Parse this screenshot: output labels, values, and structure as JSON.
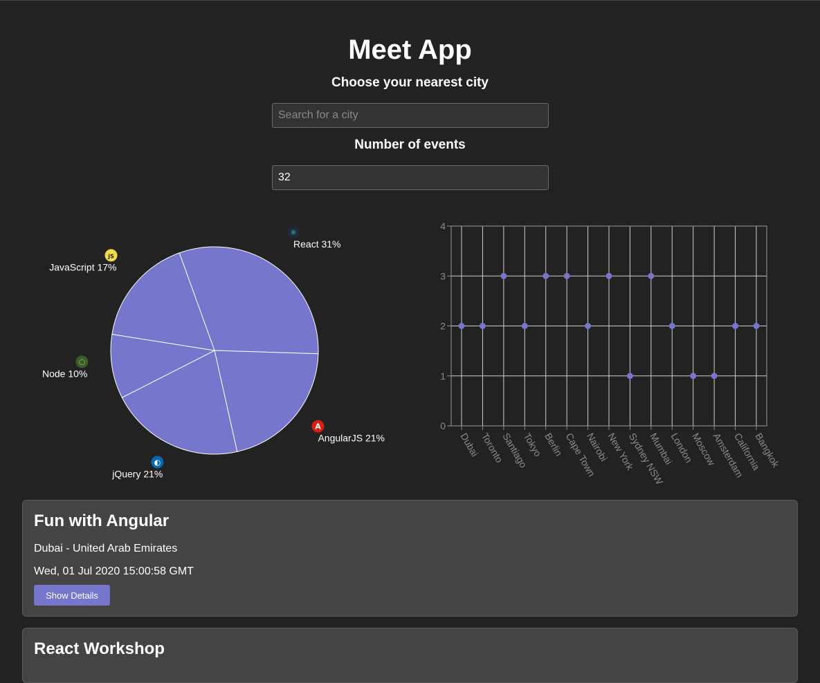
{
  "app": {
    "title": "Meet App"
  },
  "city_search": {
    "label": "Choose your nearest city",
    "placeholder": "Search for a city",
    "value": ""
  },
  "number_of_events": {
    "label": "Number of events",
    "value": "32"
  },
  "colors": {
    "background": "#222222",
    "accent": "#7676cc",
    "card": "#444444"
  },
  "chart_data": [
    {
      "type": "pie",
      "slices": [
        {
          "label": "React 31%",
          "value": 31,
          "icon": "react-logo"
        },
        {
          "label": "AngularJS 21%",
          "value": 21,
          "icon": "angular-logo"
        },
        {
          "label": "jQuery 21%",
          "value": 21,
          "icon": "jquery-logo"
        },
        {
          "label": "Node 10%",
          "value": 10,
          "icon": "node-logo"
        },
        {
          "label": "JavaScript 17%",
          "value": 17,
          "icon": "javascript-logo"
        }
      ]
    },
    {
      "type": "scatter",
      "categories": [
        "Dubai",
        "Toronto",
        "Santiago",
        "Tokyo",
        "Berlin",
        "Cape Town",
        "Nairobi",
        "New York",
        "Sydney NSW",
        "Mumbai",
        "London",
        "Moscow",
        "Amsterdam",
        "California",
        "Bangkok"
      ],
      "values": [
        2,
        2,
        3,
        2,
        3,
        3,
        2,
        3,
        1,
        3,
        2,
        1,
        1,
        2,
        2
      ],
      "yticks": [
        0,
        1,
        2,
        3,
        4
      ],
      "ylim": [
        0,
        4
      ],
      "grid": true
    }
  ],
  "events": [
    {
      "title": "Fun with Angular",
      "location": "Dubai - United Arab Emirates",
      "date": "Wed, 01 Jul 2020 15:00:58 GMT",
      "button": "Show Details"
    },
    {
      "title": "React Workshop"
    }
  ]
}
